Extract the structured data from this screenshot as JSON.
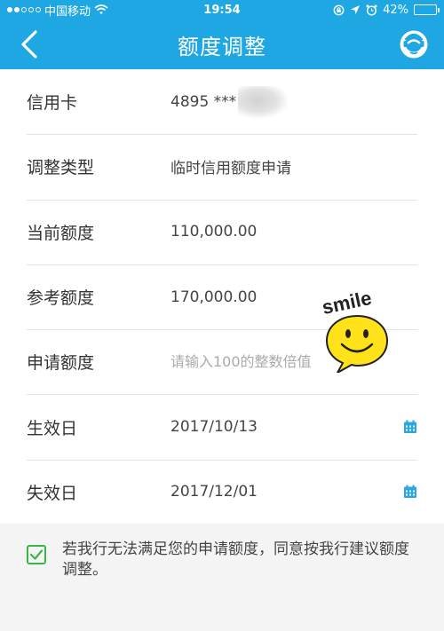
{
  "statusbar": {
    "carrier": "中国移动",
    "time": "19:54",
    "battery": "42%",
    "battery_level": 0.42,
    "signal_icon": "signal-dots-icon",
    "wifi_icon": "wifi-icon",
    "lock_icon": "rotation-lock-icon",
    "location_icon": "location-arrow-icon",
    "alarm_icon": "alarm-clock-icon"
  },
  "navbar": {
    "title": "额度调整",
    "back_icon": "chevron-left-icon",
    "service_icon": "customer-service-icon"
  },
  "form": {
    "card": {
      "label": "信用卡",
      "value": "4895 ***"
    },
    "adjust_type": {
      "label": "调整类型",
      "value": "临时信用额度申请"
    },
    "current_limit": {
      "label": "当前额度",
      "value": "110,000.00"
    },
    "reference_limit": {
      "label": "参考额度",
      "value": "170,000.00"
    },
    "apply_limit": {
      "label": "申请额度",
      "placeholder": "请输入100的整数倍值"
    },
    "effective_date": {
      "label": "生效日",
      "value": "2017/10/13",
      "icon": "calendar-icon"
    },
    "expire_date": {
      "label": "失效日",
      "value": "2017/12/01",
      "icon": "calendar-icon"
    }
  },
  "agreement": {
    "checked": true,
    "text": "若我行无法满足您的申请额度，同意按我行建议额度调整。"
  },
  "sticker": {
    "text": "smile",
    "icon": "smiley-face-icon"
  },
  "colors": {
    "brand": "#1ea7e3",
    "check": "#3ab54a",
    "calendar": "#2aa7e0",
    "smiley": "#ffe21a"
  }
}
